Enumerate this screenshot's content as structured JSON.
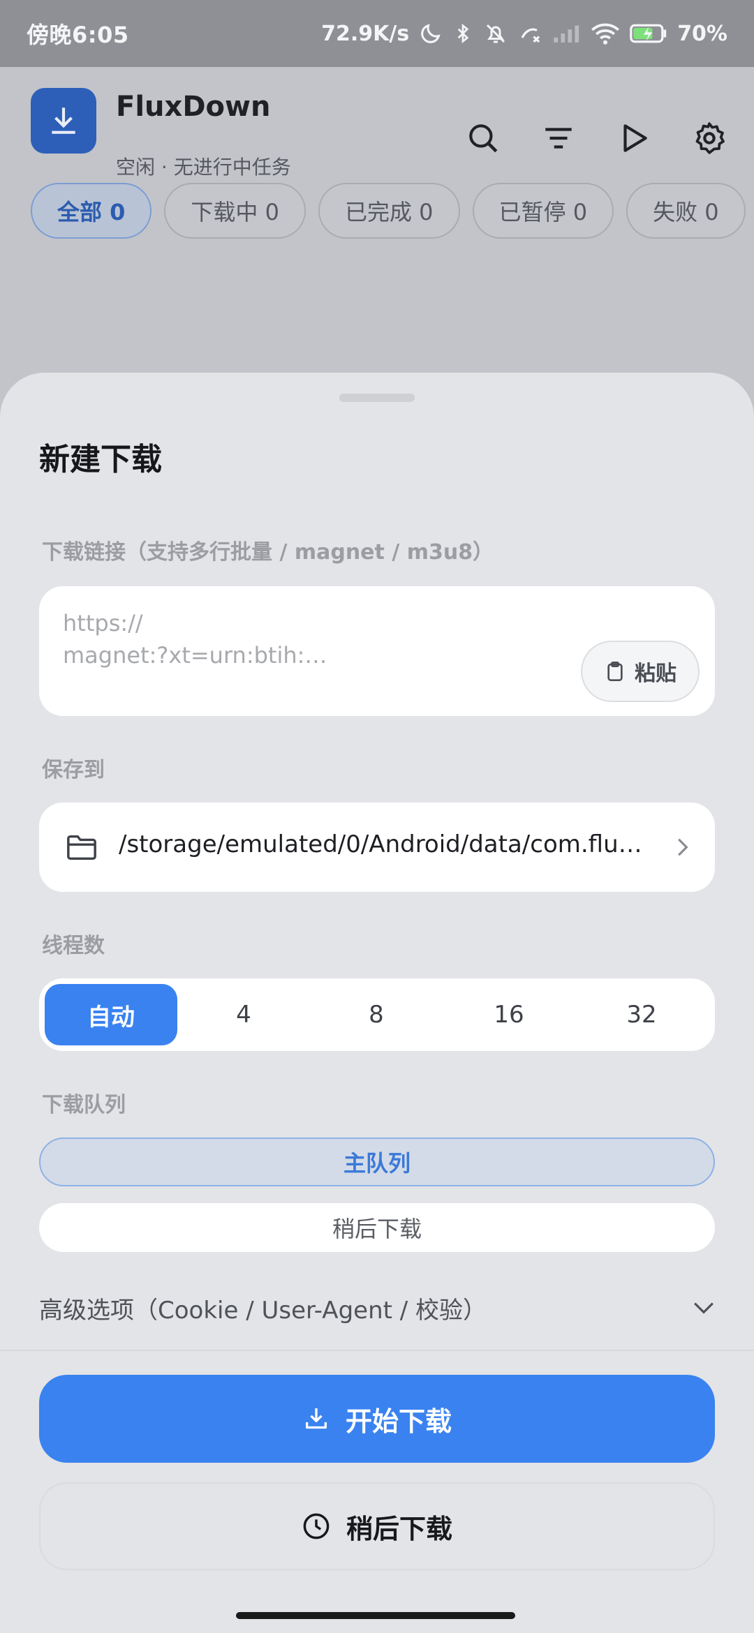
{
  "status_bar": {
    "time": "傍晚6:05",
    "speed": "72.9K/s",
    "battery": "70%"
  },
  "app": {
    "title": "FluxDown",
    "subtitle": "空闲 · 无进行中任务",
    "icons": [
      "search-icon",
      "filter-icon",
      "play-icon",
      "gear-icon"
    ],
    "filters": [
      {
        "label": "全部 0",
        "active": true
      },
      {
        "label": "下载中 0",
        "active": false
      },
      {
        "label": "已完成 0",
        "active": false
      },
      {
        "label": "已暂停 0",
        "active": false
      },
      {
        "label": "失败 0",
        "active": false
      }
    ]
  },
  "sheet": {
    "title": "新建下载",
    "url_label": "下载链接（支持多行批量 / magnet / m3u8）",
    "url_placeholder": "https://\nmagnet:?xt=urn:btih:…",
    "paste_label": "粘贴",
    "save_label": "保存到",
    "save_path": "/storage/emulated/0/Android/data/com.flu…",
    "threads_label": "线程数",
    "threads": [
      "自动",
      "4",
      "8",
      "16",
      "32"
    ],
    "threads_selected": "自动",
    "queue_label": "下载队列",
    "queues": [
      "主队列",
      "稍后下载"
    ],
    "queue_selected": "主队列",
    "advanced_label": "高级选项（Cookie / User-Agent / 校验）",
    "start_label": "开始下载",
    "later_label": "稍后下载"
  },
  "colors": {
    "accent": "#3a82f0",
    "logo": "#2d5fb9",
    "sheet_bg": "#e3e4e7",
    "card_bg": "#ffffff"
  }
}
